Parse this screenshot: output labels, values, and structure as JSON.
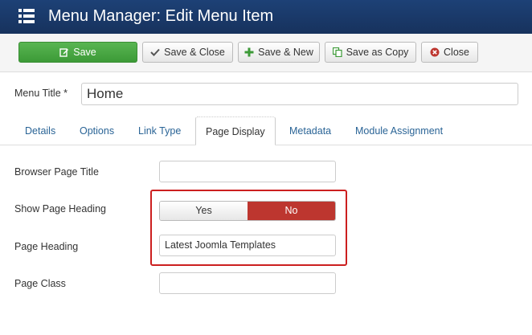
{
  "header": {
    "title": "Menu Manager: Edit Menu Item",
    "icon": "menu-list-icon"
  },
  "toolbar": {
    "save_label": "Save",
    "save_close_label": "Save & Close",
    "save_new_label": "Save & New",
    "save_copy_label": "Save as Copy",
    "close_label": "Close"
  },
  "form": {
    "menu_title_label": "Menu Title *",
    "menu_title_value": "Home"
  },
  "tabs": [
    {
      "label": "Details"
    },
    {
      "label": "Options"
    },
    {
      "label": "Link Type"
    },
    {
      "label": "Page Display"
    },
    {
      "label": "Metadata"
    },
    {
      "label": "Module Assignment"
    }
  ],
  "fields": {
    "browser_page_title_label": "Browser Page Title",
    "browser_page_title_value": "",
    "show_heading_label": "Show Page Heading",
    "show_heading_yes": "Yes",
    "show_heading_no": "No",
    "show_heading_selected": "No",
    "page_heading_label": "Page Heading",
    "page_heading_value": "Latest Joomla Templates",
    "page_class_label": "Page Class",
    "page_class_value": ""
  },
  "colors": {
    "header_bg": "#1d4176",
    "save_green": "#46a546",
    "no_red": "#bd362f",
    "highlight_red": "#cc1f1f",
    "link_blue": "#2a6496"
  }
}
